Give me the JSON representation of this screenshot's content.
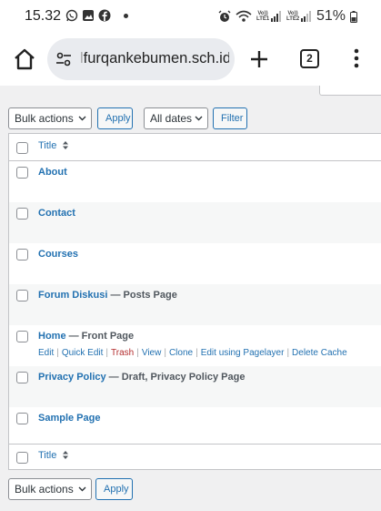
{
  "status_bar": {
    "time": "15.32",
    "icons": [
      "whatsapp-icon",
      "gallery-icon",
      "facebook-icon",
      "notification-dot"
    ],
    "right_icons": [
      "alarm-icon",
      "wifi-icon",
      "signal-lte1-icon",
      "signal-lte2-icon",
      "battery-icon"
    ],
    "lte1_label": "Vo)) LTE1",
    "lte2_label": "Vo)) LTE2",
    "battery": "51%"
  },
  "browser": {
    "url_prefix": "l",
    "url": "furqankebumen.sch.id",
    "tab_count": "2"
  },
  "top_actions": {
    "bulk_actions": "Bulk actions",
    "apply": "Apply",
    "all_dates": "All dates",
    "filter": "Filter"
  },
  "table": {
    "header_title": "Title",
    "footer_title": "Title",
    "rows": [
      {
        "title": "About",
        "state": ""
      },
      {
        "title": "Contact",
        "state": ""
      },
      {
        "title": "Courses",
        "state": ""
      },
      {
        "title": "Forum Diskusi",
        "state": " — Posts Page"
      },
      {
        "title": "Home",
        "state": " — Front Page"
      },
      {
        "title": "Privacy Policy",
        "state": " — Draft, Privacy Policy Page"
      },
      {
        "title": "Sample Page",
        "state": ""
      }
    ],
    "row_actions": {
      "edit": "Edit",
      "quick_edit": "Quick Edit",
      "trash": "Trash",
      "view": "View",
      "clone": "Clone",
      "edit_pagelayer": "Edit using Pagelayer",
      "delete_cache": "Delete Cache"
    }
  },
  "bottom_actions": {
    "bulk_actions": "Bulk actions",
    "apply": "Apply"
  },
  "colors": {
    "link": "#2271b1",
    "trash": "#b32d2e",
    "background": "#f0f0f1"
  }
}
